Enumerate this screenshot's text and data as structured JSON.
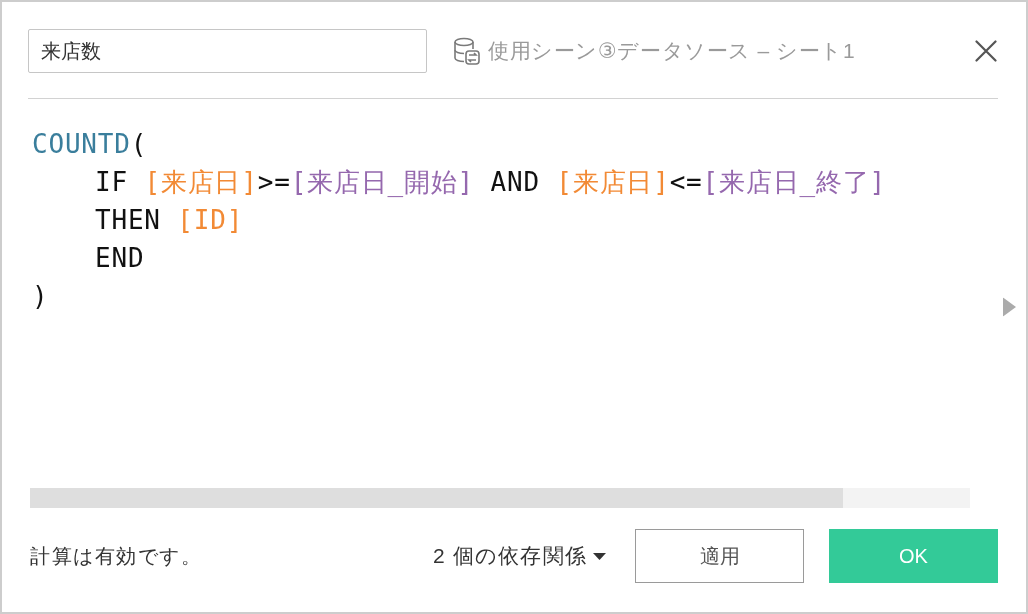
{
  "calculation": {
    "name": "来店数",
    "data_source": "使用シーン③データソース – シート1"
  },
  "code": {
    "lines": [
      {
        "runs": [
          [
            {
              "kind": "function",
              "text": "COUNTD"
            },
            {
              "kind": "punctuation",
              "text": "("
            }
          ]
        ],
        "children": [
          {
            "runs": [
              [
                {
                  "kind": "keyword",
                  "text": "IF"
                }
              ],
              [
                {
                  "kind": "field",
                  "text": "[来店日]"
                },
                {
                  "kind": "operator",
                  "text": ">="
                },
                {
                  "kind": "parameter",
                  "text": "[来店日_開始]"
                }
              ],
              [
                {
                  "kind": "keyword",
                  "text": "AND"
                }
              ],
              [
                {
                  "kind": "field",
                  "text": "[来店日]"
                },
                {
                  "kind": "operator",
                  "text": "<="
                },
                {
                  "kind": "parameter",
                  "text": "[来店日_終了]"
                }
              ]
            ]
          },
          {
            "runs": [
              [
                {
                  "kind": "keyword",
                  "text": "THEN"
                }
              ],
              [
                {
                  "kind": "field",
                  "text": "[ID]"
                }
              ]
            ]
          },
          {
            "runs": [
              [
                {
                  "kind": "keyword",
                  "text": "END"
                }
              ]
            ]
          }
        ]
      },
      {
        "runs": [
          [
            {
              "kind": "punctuation",
              "text": ")"
            }
          ]
        ]
      }
    ]
  },
  "status": "計算は有効です。",
  "dependencies": {
    "label": "2 個の依存関係"
  },
  "buttons": [
    {
      "label": "適用",
      "kind": "secondary"
    },
    {
      "label": "OK",
      "kind": "primary"
    }
  ]
}
